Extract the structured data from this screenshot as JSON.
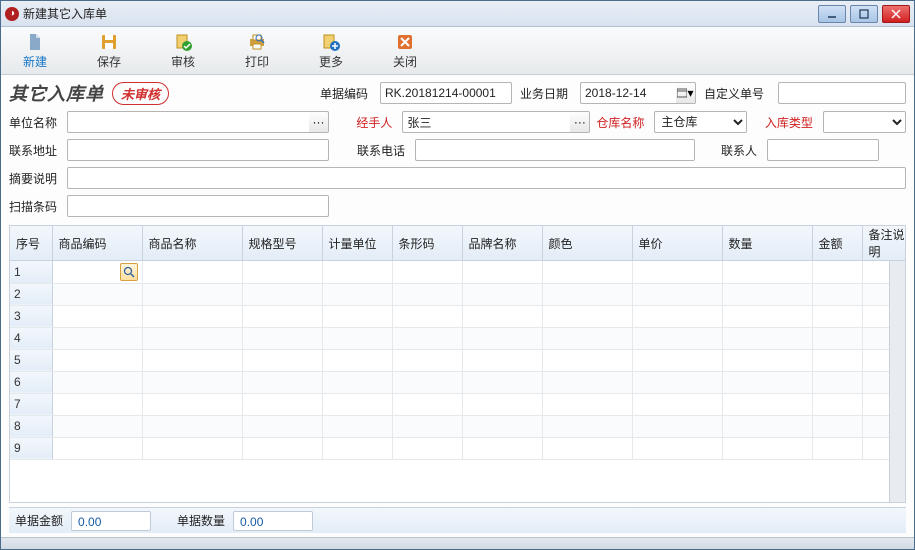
{
  "window": {
    "title": "新建其它入库单"
  },
  "toolbar": {
    "new": "新建",
    "save": "保存",
    "audit": "审核",
    "print": "打印",
    "more": "更多",
    "close": "关闭"
  },
  "document": {
    "title": "其它入库单",
    "stamp": "未审核"
  },
  "labels": {
    "doc_no": "单据编码",
    "biz_date": "业务日期",
    "custom_no": "自定义单号",
    "unit_name": "单位名称",
    "handler": "经手人",
    "warehouse": "仓库名称",
    "in_type": "入库类型",
    "addr": "联系地址",
    "phone": "联系电话",
    "contact": "联系人",
    "summary": "摘要说明",
    "barcode": "扫描条码"
  },
  "values": {
    "doc_no": "RK.20181214-00001",
    "biz_date": "2018-12-14",
    "custom_no": "",
    "unit_name": "",
    "handler": "张三",
    "warehouse": "主仓库",
    "in_type": "",
    "addr": "",
    "phone": "",
    "contact": "",
    "summary": "",
    "barcode": ""
  },
  "grid": {
    "columns": [
      "序号",
      "商品编码",
      "商品名称",
      "规格型号",
      "计量单位",
      "条形码",
      "品牌名称",
      "颜色",
      "单价",
      "数量",
      "金额",
      "备注说明"
    ],
    "row_count": 9
  },
  "footer": {
    "amount_label": "单据金额",
    "amount_value": "0.00",
    "qty_label": "单据数量",
    "qty_value": "0.00"
  }
}
